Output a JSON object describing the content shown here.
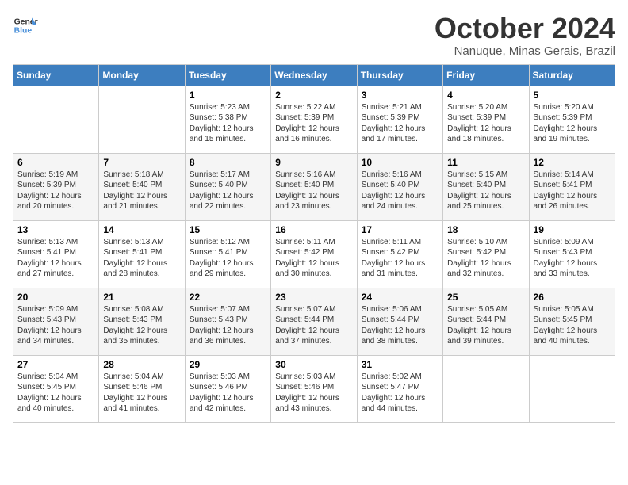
{
  "logo": {
    "line1": "General",
    "line2": "Blue"
  },
  "title": "October 2024",
  "location": "Nanuque, Minas Gerais, Brazil",
  "weekdays": [
    "Sunday",
    "Monday",
    "Tuesday",
    "Wednesday",
    "Thursday",
    "Friday",
    "Saturday"
  ],
  "weeks": [
    [
      {
        "day": "",
        "sunrise": "",
        "sunset": "",
        "daylight": ""
      },
      {
        "day": "",
        "sunrise": "",
        "sunset": "",
        "daylight": ""
      },
      {
        "day": "1",
        "sunrise": "Sunrise: 5:23 AM",
        "sunset": "Sunset: 5:38 PM",
        "daylight": "Daylight: 12 hours and 15 minutes."
      },
      {
        "day": "2",
        "sunrise": "Sunrise: 5:22 AM",
        "sunset": "Sunset: 5:39 PM",
        "daylight": "Daylight: 12 hours and 16 minutes."
      },
      {
        "day": "3",
        "sunrise": "Sunrise: 5:21 AM",
        "sunset": "Sunset: 5:39 PM",
        "daylight": "Daylight: 12 hours and 17 minutes."
      },
      {
        "day": "4",
        "sunrise": "Sunrise: 5:20 AM",
        "sunset": "Sunset: 5:39 PM",
        "daylight": "Daylight: 12 hours and 18 minutes."
      },
      {
        "day": "5",
        "sunrise": "Sunrise: 5:20 AM",
        "sunset": "Sunset: 5:39 PM",
        "daylight": "Daylight: 12 hours and 19 minutes."
      }
    ],
    [
      {
        "day": "6",
        "sunrise": "Sunrise: 5:19 AM",
        "sunset": "Sunset: 5:39 PM",
        "daylight": "Daylight: 12 hours and 20 minutes."
      },
      {
        "day": "7",
        "sunrise": "Sunrise: 5:18 AM",
        "sunset": "Sunset: 5:40 PM",
        "daylight": "Daylight: 12 hours and 21 minutes."
      },
      {
        "day": "8",
        "sunrise": "Sunrise: 5:17 AM",
        "sunset": "Sunset: 5:40 PM",
        "daylight": "Daylight: 12 hours and 22 minutes."
      },
      {
        "day": "9",
        "sunrise": "Sunrise: 5:16 AM",
        "sunset": "Sunset: 5:40 PM",
        "daylight": "Daylight: 12 hours and 23 minutes."
      },
      {
        "day": "10",
        "sunrise": "Sunrise: 5:16 AM",
        "sunset": "Sunset: 5:40 PM",
        "daylight": "Daylight: 12 hours and 24 minutes."
      },
      {
        "day": "11",
        "sunrise": "Sunrise: 5:15 AM",
        "sunset": "Sunset: 5:40 PM",
        "daylight": "Daylight: 12 hours and 25 minutes."
      },
      {
        "day": "12",
        "sunrise": "Sunrise: 5:14 AM",
        "sunset": "Sunset: 5:41 PM",
        "daylight": "Daylight: 12 hours and 26 minutes."
      }
    ],
    [
      {
        "day": "13",
        "sunrise": "Sunrise: 5:13 AM",
        "sunset": "Sunset: 5:41 PM",
        "daylight": "Daylight: 12 hours and 27 minutes."
      },
      {
        "day": "14",
        "sunrise": "Sunrise: 5:13 AM",
        "sunset": "Sunset: 5:41 PM",
        "daylight": "Daylight: 12 hours and 28 minutes."
      },
      {
        "day": "15",
        "sunrise": "Sunrise: 5:12 AM",
        "sunset": "Sunset: 5:41 PM",
        "daylight": "Daylight: 12 hours and 29 minutes."
      },
      {
        "day": "16",
        "sunrise": "Sunrise: 5:11 AM",
        "sunset": "Sunset: 5:42 PM",
        "daylight": "Daylight: 12 hours and 30 minutes."
      },
      {
        "day": "17",
        "sunrise": "Sunrise: 5:11 AM",
        "sunset": "Sunset: 5:42 PM",
        "daylight": "Daylight: 12 hours and 31 minutes."
      },
      {
        "day": "18",
        "sunrise": "Sunrise: 5:10 AM",
        "sunset": "Sunset: 5:42 PM",
        "daylight": "Daylight: 12 hours and 32 minutes."
      },
      {
        "day": "19",
        "sunrise": "Sunrise: 5:09 AM",
        "sunset": "Sunset: 5:43 PM",
        "daylight": "Daylight: 12 hours and 33 minutes."
      }
    ],
    [
      {
        "day": "20",
        "sunrise": "Sunrise: 5:09 AM",
        "sunset": "Sunset: 5:43 PM",
        "daylight": "Daylight: 12 hours and 34 minutes."
      },
      {
        "day": "21",
        "sunrise": "Sunrise: 5:08 AM",
        "sunset": "Sunset: 5:43 PM",
        "daylight": "Daylight: 12 hours and 35 minutes."
      },
      {
        "day": "22",
        "sunrise": "Sunrise: 5:07 AM",
        "sunset": "Sunset: 5:43 PM",
        "daylight": "Daylight: 12 hours and 36 minutes."
      },
      {
        "day": "23",
        "sunrise": "Sunrise: 5:07 AM",
        "sunset": "Sunset: 5:44 PM",
        "daylight": "Daylight: 12 hours and 37 minutes."
      },
      {
        "day": "24",
        "sunrise": "Sunrise: 5:06 AM",
        "sunset": "Sunset: 5:44 PM",
        "daylight": "Daylight: 12 hours and 38 minutes."
      },
      {
        "day": "25",
        "sunrise": "Sunrise: 5:05 AM",
        "sunset": "Sunset: 5:44 PM",
        "daylight": "Daylight: 12 hours and 39 minutes."
      },
      {
        "day": "26",
        "sunrise": "Sunrise: 5:05 AM",
        "sunset": "Sunset: 5:45 PM",
        "daylight": "Daylight: 12 hours and 40 minutes."
      }
    ],
    [
      {
        "day": "27",
        "sunrise": "Sunrise: 5:04 AM",
        "sunset": "Sunset: 5:45 PM",
        "daylight": "Daylight: 12 hours and 40 minutes."
      },
      {
        "day": "28",
        "sunrise": "Sunrise: 5:04 AM",
        "sunset": "Sunset: 5:46 PM",
        "daylight": "Daylight: 12 hours and 41 minutes."
      },
      {
        "day": "29",
        "sunrise": "Sunrise: 5:03 AM",
        "sunset": "Sunset: 5:46 PM",
        "daylight": "Daylight: 12 hours and 42 minutes."
      },
      {
        "day": "30",
        "sunrise": "Sunrise: 5:03 AM",
        "sunset": "Sunset: 5:46 PM",
        "daylight": "Daylight: 12 hours and 43 minutes."
      },
      {
        "day": "31",
        "sunrise": "Sunrise: 5:02 AM",
        "sunset": "Sunset: 5:47 PM",
        "daylight": "Daylight: 12 hours and 44 minutes."
      },
      {
        "day": "",
        "sunrise": "",
        "sunset": "",
        "daylight": ""
      },
      {
        "day": "",
        "sunrise": "",
        "sunset": "",
        "daylight": ""
      }
    ]
  ]
}
